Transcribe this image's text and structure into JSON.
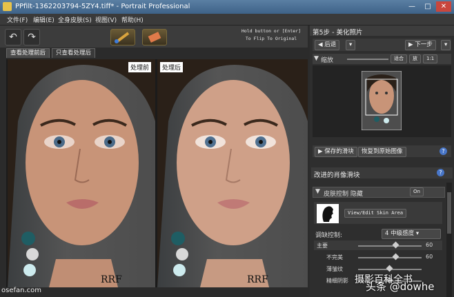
{
  "window": {
    "title": "PPfilt-1362203794-5ZY4.tiff* - Portrait Professional"
  },
  "menu": [
    "文件(F)",
    "编辑(E)",
    "全身皮肤(S)",
    "视图(V)",
    "帮助(H)"
  ],
  "toolbar": {
    "hint": [
      "Hold button or [Enter]",
      "To Flip To Original"
    ]
  },
  "tabs": [
    "查看处理前后",
    "只查看处理后"
  ],
  "panes": {
    "before_label": "处理前",
    "after_label": "处理后",
    "logo": "RRF"
  },
  "right": {
    "step_title": "第5步 - 美化照片",
    "back_label": "后退",
    "next_label": "下一步",
    "zoom_label": "缩放",
    "zoom_buttons": [
      "适合",
      "放",
      "1:1"
    ],
    "presets_label": "保存的滑块",
    "restore_label": "恢复到原始图像",
    "portrait_section": "改进的肖像滑块",
    "skin_section": "皮肤控制 隐藏",
    "on_label": "On",
    "skin_area_button": "View/Edit Skin Area",
    "smooth_label": "调缺控制:",
    "smooth_value": "4 中级感度",
    "sliders": [
      {
        "label": "主要",
        "value": "60",
        "level": 0.6
      },
      {
        "label": "不完美",
        "value": "60",
        "level": 0.6
      },
      {
        "label": "薄皱纹",
        "value": "",
        "level": 0.5
      },
      {
        "label": "精细阴影",
        "value": "",
        "level": 0.5
      }
    ]
  },
  "overlay": {
    "left_watermark": "osefan.com",
    "brand": "头条 @dowhe",
    "mid_text": "摄影百科全书"
  }
}
